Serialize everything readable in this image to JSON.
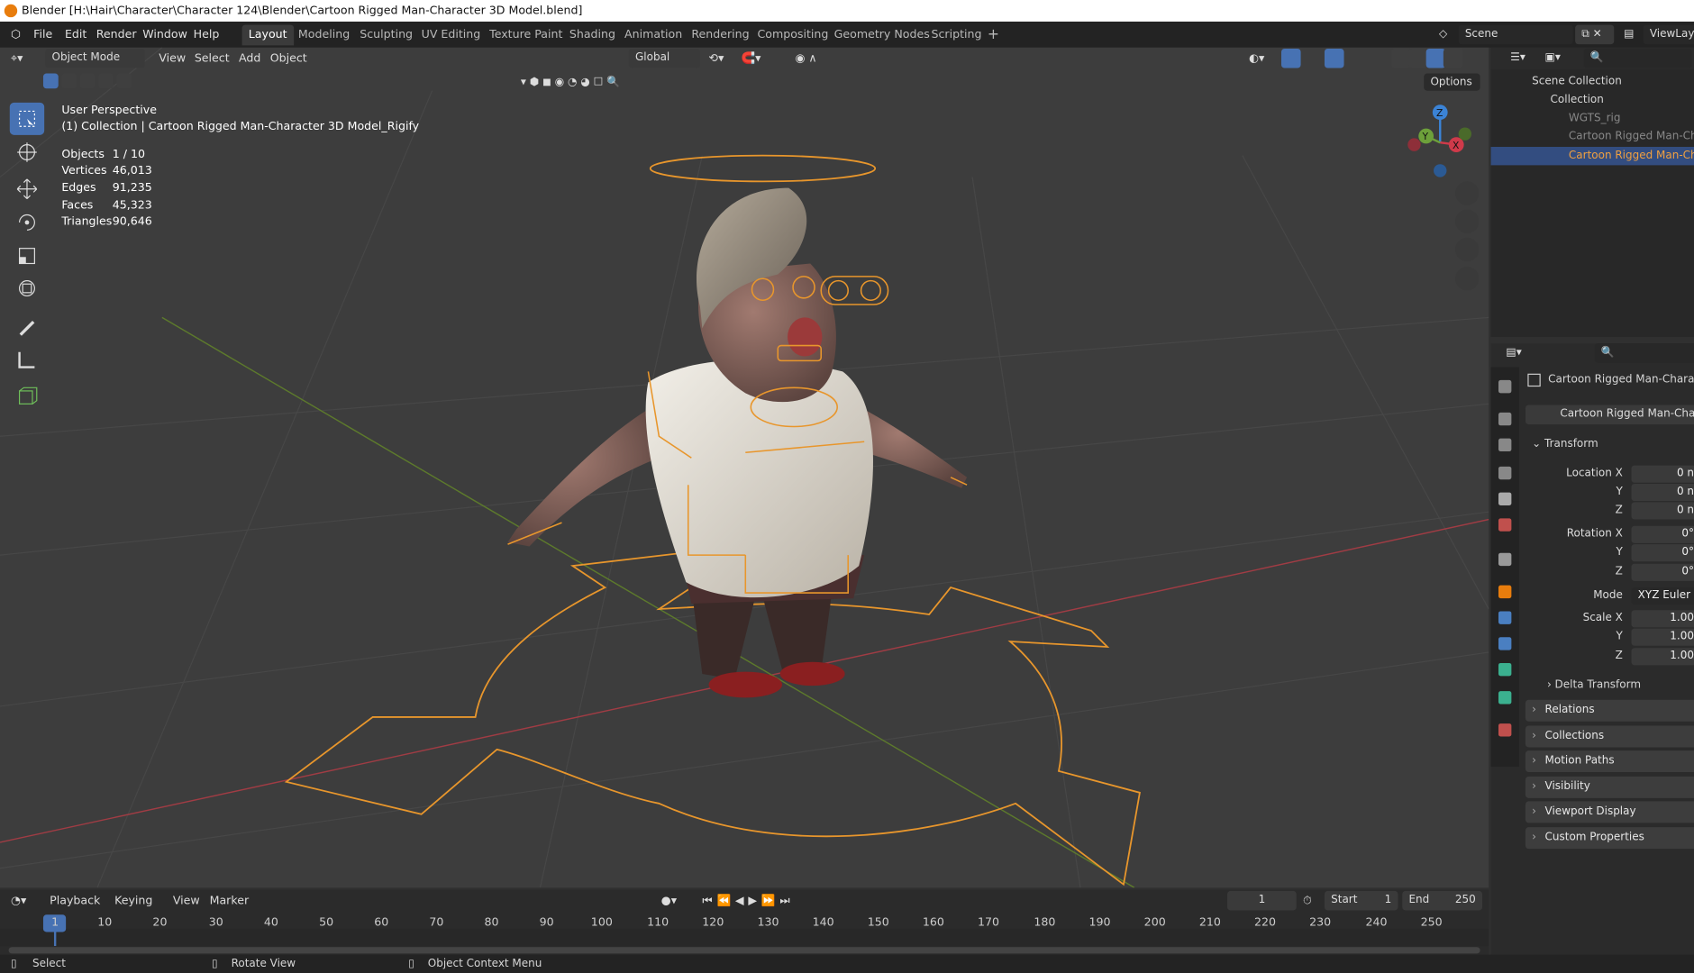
{
  "window": {
    "title": "Blender [H:\\Hair\\Character\\Character 124\\Blender\\Cartoon Rigged Man-Character 3D Model.blend]"
  },
  "menus": [
    "File",
    "Edit",
    "Render",
    "Window",
    "Help"
  ],
  "workspaces": [
    "Layout",
    "Modeling",
    "Sculpting",
    "UV Editing",
    "Texture Paint",
    "Shading",
    "Animation",
    "Rendering",
    "Compositing",
    "Geometry Nodes",
    "Scripting"
  ],
  "scene": {
    "name": "Scene",
    "view_layer": "ViewLaye"
  },
  "viewport_header": {
    "mode": "Object Mode",
    "menus": [
      "View",
      "Select",
      "Add",
      "Object"
    ],
    "orientation": "Global",
    "options": "Options"
  },
  "overlay": {
    "perspective": "User Perspective",
    "collection": "(1) Collection | Cartoon Rigged Man-Character 3D Model_Rigify",
    "stats": [
      {
        "label": "Objects",
        "value": "1 / 10"
      },
      {
        "label": "Vertices",
        "value": "46,013"
      },
      {
        "label": "Edges",
        "value": "91,235"
      },
      {
        "label": "Faces",
        "value": "45,323"
      },
      {
        "label": "Triangles",
        "value": "90,646"
      }
    ]
  },
  "gizmo": {
    "x": "X",
    "y": "Y",
    "z": "Z"
  },
  "outliner": {
    "items": [
      {
        "label": "Scene Collection"
      },
      {
        "label": "Collection"
      },
      {
        "label": "WGTS_rig"
      },
      {
        "label": "Cartoon Rigged Man-Chara"
      },
      {
        "label": "Cartoon Rigged Man-Chara"
      }
    ]
  },
  "properties": {
    "object_name": "Cartoon Rigged Man-Character",
    "data_name": "Cartoon Rigged Man-Charact",
    "transform_label": "Transform",
    "location": {
      "x_label": "Location X",
      "y_label": "Y",
      "z_label": "Z",
      "x": "0 n",
      "y": "0 n",
      "z": "0 n"
    },
    "rotation": {
      "x_label": "Rotation X",
      "y_label": "Y",
      "z_label": "Z",
      "x": "0°",
      "y": "0°",
      "z": "0°"
    },
    "mode_label": "Mode",
    "mode": "XYZ Euler",
    "scale": {
      "x_label": "Scale X",
      "y_label": "Y",
      "z_label": "Z",
      "x": "1.00",
      "y": "1.00",
      "z": "1.00"
    },
    "delta": "Delta Transform",
    "panels": [
      "Relations",
      "Collections",
      "Motion Paths",
      "Visibility",
      "Viewport Display",
      "Custom Properties"
    ]
  },
  "timeline": {
    "menus": [
      "Playback",
      "Keying",
      "View",
      "Marker"
    ],
    "current_frame": "1",
    "start_label": "Start",
    "start": "1",
    "end_label": "End",
    "end": "250",
    "ruler": [
      "1",
      "10",
      "20",
      "30",
      "40",
      "50",
      "60",
      "70",
      "80",
      "90",
      "100",
      "110",
      "120",
      "130",
      "140",
      "150",
      "160",
      "170",
      "180",
      "190",
      "200",
      "210",
      "220",
      "230",
      "240",
      "250"
    ]
  },
  "statusbar": {
    "select": "Select",
    "rotate": "Rotate View",
    "context": "Object Context Menu"
  },
  "colors": {
    "accent": "#4772b3",
    "selection": "#e87d0d",
    "x_axis": "#cf3a4a",
    "y_axis": "#6da03a",
    "z_axis": "#3b83d6"
  }
}
